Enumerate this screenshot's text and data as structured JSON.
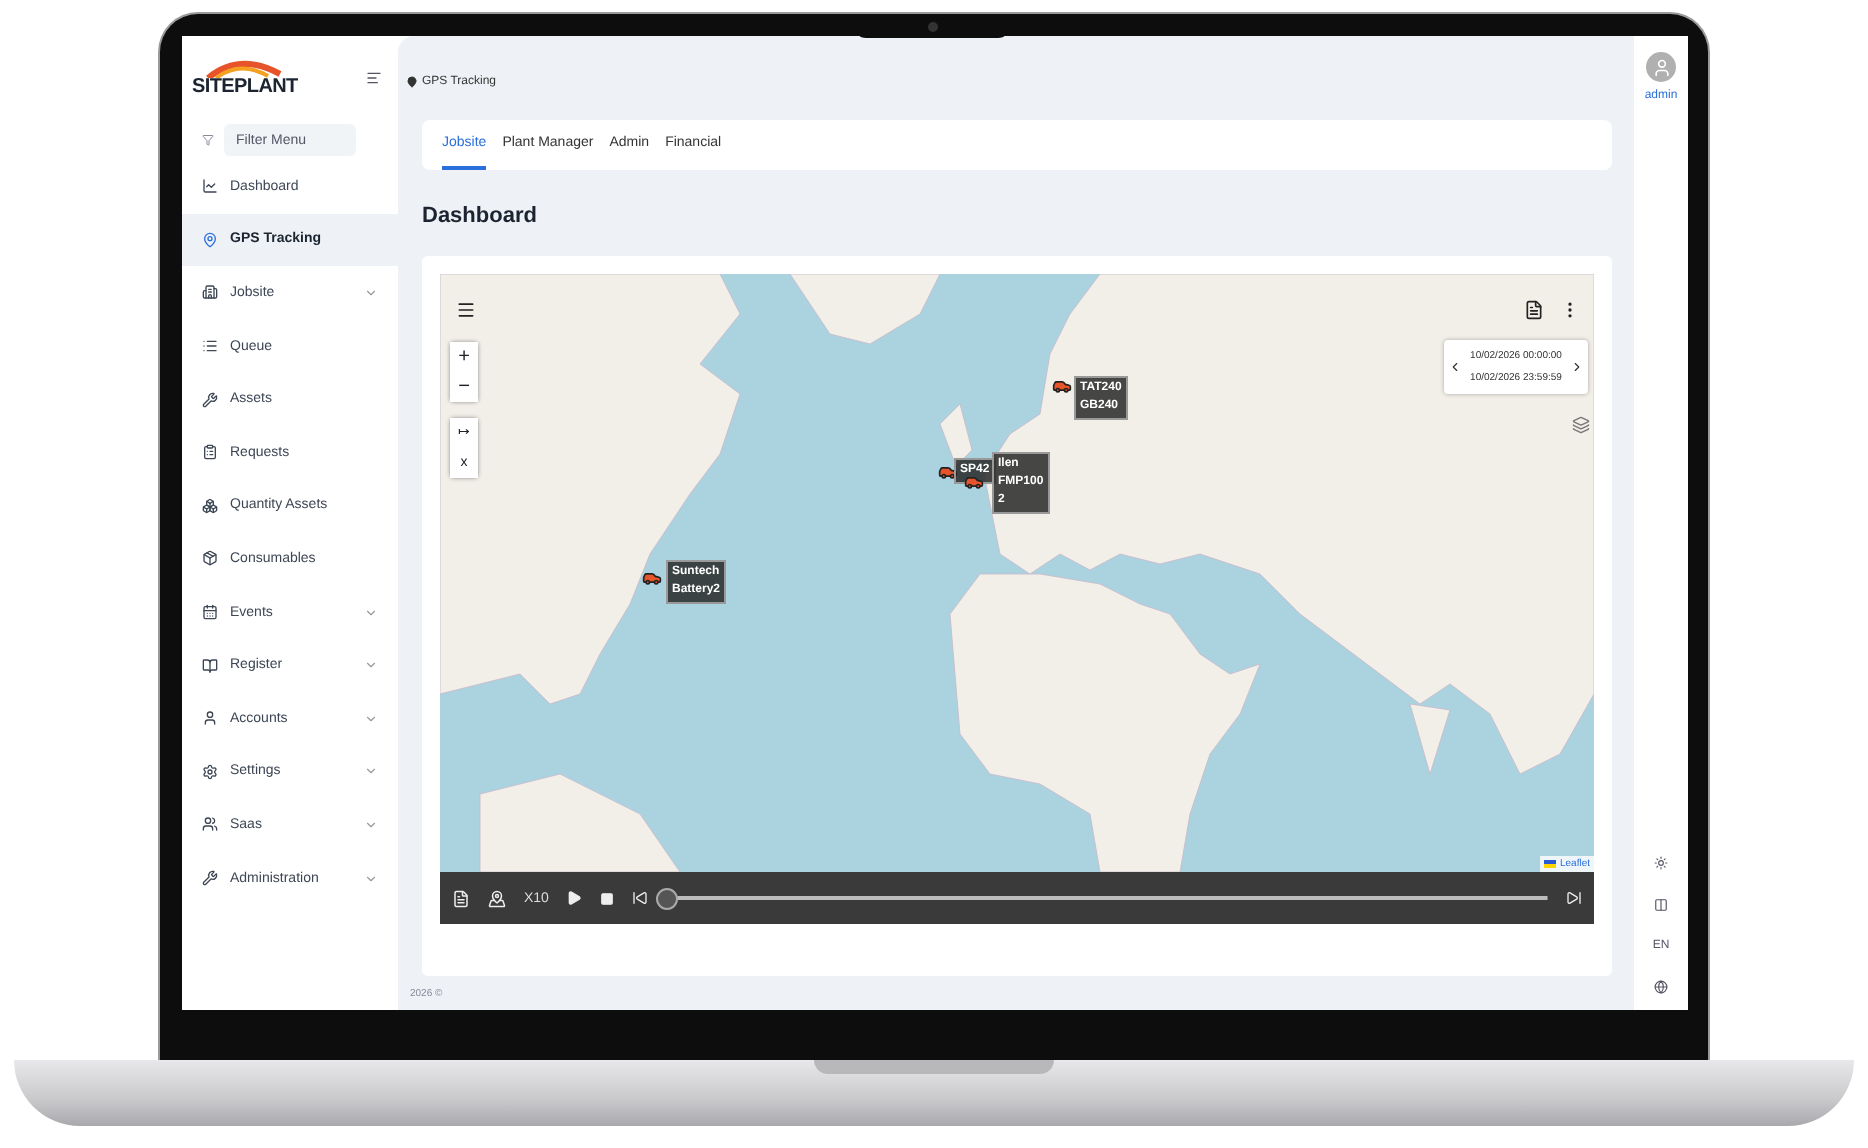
{
  "sidebar": {
    "logo": "SITEPLANT",
    "filter": {
      "placeholder": "Filter Menu"
    },
    "items": [
      {
        "label": "Dashboard",
        "expandable": false,
        "selected": false
      },
      {
        "label": "GPS Tracking",
        "expandable": false,
        "selected": true
      },
      {
        "label": "Jobsite",
        "expandable": true,
        "selected": false
      },
      {
        "label": "Queue",
        "expandable": false,
        "selected": false
      },
      {
        "label": "Assets",
        "expandable": false,
        "selected": false
      },
      {
        "label": "Requests",
        "expandable": false,
        "selected": false
      },
      {
        "label": "Quantity Assets",
        "expandable": false,
        "selected": false
      },
      {
        "label": "Consumables",
        "expandable": false,
        "selected": false
      },
      {
        "label": "Events",
        "expandable": true,
        "selected": false
      },
      {
        "label": "Register",
        "expandable": true,
        "selected": false
      },
      {
        "label": "Accounts",
        "expandable": true,
        "selected": false
      },
      {
        "label": "Settings",
        "expandable": true,
        "selected": false
      },
      {
        "label": "Saas",
        "expandable": true,
        "selected": false
      },
      {
        "label": "Administration",
        "expandable": true,
        "selected": false
      }
    ]
  },
  "breadcrumb": "GPS Tracking",
  "tabs": [
    {
      "label": "Jobsite",
      "selected": true
    },
    {
      "label": "Plant Manager",
      "selected": false
    },
    {
      "label": "Admin",
      "selected": false
    },
    {
      "label": "Financial",
      "selected": false
    }
  ],
  "heading": "Dashboard",
  "map": {
    "zoom_controls": [
      "+",
      "−"
    ],
    "tool_controls": [
      "↦",
      "x"
    ],
    "date_range": {
      "from": "10/02/2026 00:00:00",
      "to": "10/02/2026 23:59:59"
    },
    "markers": [
      {
        "lines": [
          "Suntech",
          "Battery2"
        ]
      },
      {
        "lines": [
          "TAT240",
          "GB240"
        ]
      },
      {
        "lines": [
          "SP42"
        ]
      },
      {
        "lines": [
          "Ilen",
          "FMP100",
          "2"
        ]
      }
    ],
    "attribution": "Leaflet"
  },
  "player": {
    "speed": "X10",
    "level": 0
  },
  "footer": "2026 ©",
  "user": {
    "name": "admin",
    "language": "EN"
  }
}
